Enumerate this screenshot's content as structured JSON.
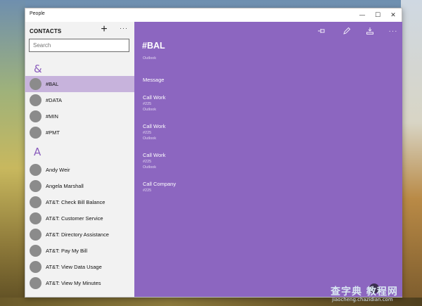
{
  "window": {
    "title": "People",
    "controls": {
      "minimize": "—",
      "maximize": "☐",
      "close": "✕"
    }
  },
  "sidebar": {
    "header": "CONTACTS",
    "add_icon": "plus-icon",
    "more_label": "···",
    "search_placeholder": "Search",
    "groups": [
      {
        "letter": "&",
        "contacts": [
          "#BAL",
          "#DATA",
          "#MIN",
          "#PMT"
        ]
      },
      {
        "letter": "A",
        "contacts": [
          "Andy Weir",
          "Angela Marshall",
          "AT&T: Check Bill Balance",
          "AT&T: Customer Service",
          "AT&T: Directory Assistance",
          "AT&T: Pay My Bill",
          "AT&T: View Data Usage",
          "AT&T: View My Minutes"
        ]
      }
    ],
    "selected": "#BAL"
  },
  "detail": {
    "toolbar": {
      "pin_icon": "pin-icon",
      "edit_icon": "pencil-icon",
      "share_icon": "share-icon",
      "more_label": "···"
    },
    "name": "#BAL",
    "source": "Outlook",
    "items": [
      {
        "action": "Message",
        "number": "",
        "source": ""
      },
      {
        "action": "Call Work",
        "number": "#225",
        "source": "Outlook"
      },
      {
        "action": "Call Work",
        "number": "#225",
        "source": "Outlook"
      },
      {
        "action": "Call Work",
        "number": "#225",
        "source": "Outlook"
      },
      {
        "action": "Call Company",
        "number": "#225",
        "source": ""
      }
    ]
  },
  "watermark": {
    "main": "查字典 教程网",
    "sub": "jiaocheng.chazidian.com"
  },
  "colors": {
    "accent": "#8c66c0",
    "selected_row": "#c7b3dc",
    "group_letter": "#8a5cbc",
    "sidebar_bg": "#f2f2f2"
  }
}
